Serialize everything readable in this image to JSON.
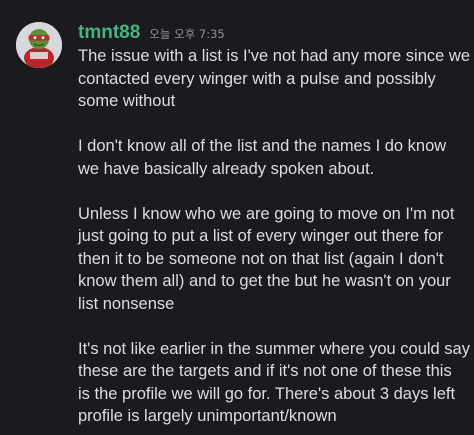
{
  "message": {
    "author": "tmnt88",
    "timestamp": "오늘 오후 7:35",
    "paragraphs": [
      {
        "lines": [
          "The issue with a list is I've not had any more since we",
          "contacted every winger with a pulse and possibly",
          "some without"
        ]
      },
      {
        "lines": [
          "I don't know all of the list and the names I do know",
          "we have basically already spoken about."
        ]
      },
      {
        "lines": [
          "Unless I know who we are going to move on I'm not",
          "just going to put a list of every winger out there for",
          "then it to be someone not on that list (again I don't",
          "know them all) and to get the but he wasn't on your",
          "list nonsense"
        ]
      },
      {
        "lines": [
          "It's not like earlier in the summer where you could say",
          "these are the targets and if it's not one of these this",
          "is the profile we will go for. There's about 3 days left",
          "profile is largely unimportant/known"
        ]
      }
    ]
  },
  "colors": {
    "background": "#1b1b1f",
    "username": "#43b581",
    "text": "#dcddde",
    "timestamp": "#8e9297"
  },
  "icons": {
    "avatar": "turtle-avatar-icon"
  }
}
